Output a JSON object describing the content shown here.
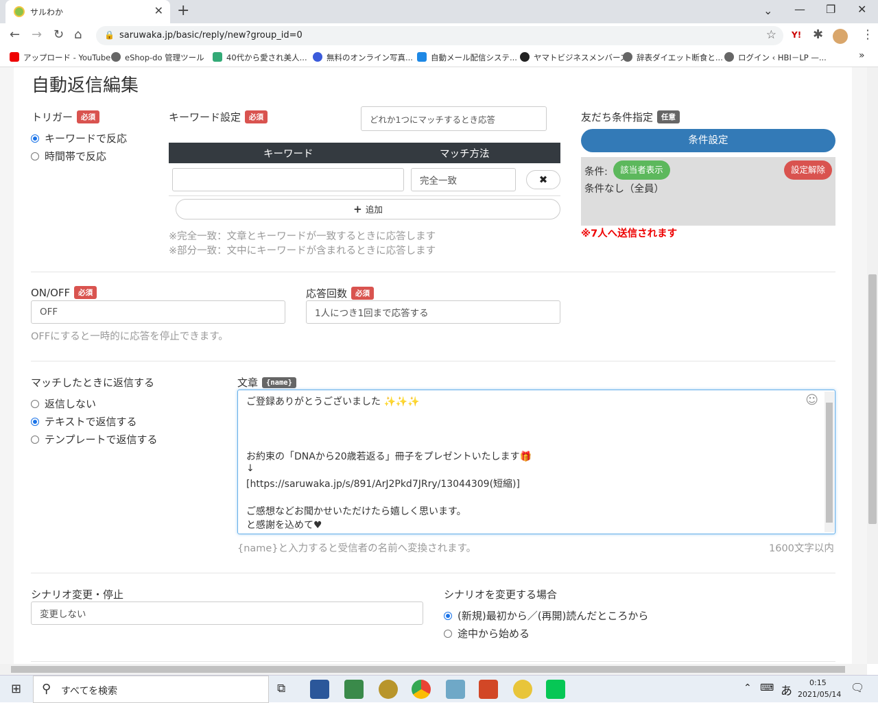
{
  "browser": {
    "tab_title": "サルわか",
    "url": "saruwaka.jp/basic/reply/new?group_id=0",
    "bookmarks": [
      "アップロード - YouTube",
      "eShop-do 管理ツール",
      "40代から愛され美人...",
      "無料のオンライン写真...",
      "自動メール配信システ...",
      "ヤマトビジネスメンバーズ",
      "辞表ダイエット断食と...",
      "ログイン ‹ HBI－LP —..."
    ]
  },
  "page": {
    "title": "自動返信編集",
    "trigger": {
      "label": "トリガー",
      "badge": "必須",
      "options": [
        "キーワードで反応",
        "時間帯で反応"
      ],
      "selected": 0
    },
    "keyword": {
      "label": "キーワード設定",
      "badge": "必須",
      "match_mode": "どれか1つにマッチするとき応答",
      "col_keyword": "キーワード",
      "col_match": "マッチ方法",
      "row_keyword": "",
      "row_match": "完全一致",
      "delete_icon": "✖",
      "add_label": "追加",
      "note1": "※完全一致：文章とキーワードが一致するときに応答します",
      "note2": "※部分一致：文中にキーワードが含まれるときに応答します"
    },
    "friend": {
      "label": "友だち条件指定",
      "badge": "任意",
      "button": "条件設定",
      "cond_label": "条件:",
      "show_target": "該当者表示",
      "clear": "設定解除",
      "cond_value": "条件なし（全員）",
      "send_note": "※7人へ送信されます"
    },
    "onoff": {
      "label": "ON/OFF",
      "badge": "必須",
      "value": "OFF",
      "note": "OFFにすると一時的に応答を停止できます。"
    },
    "count": {
      "label": "応答回数",
      "badge": "必須",
      "value": "1人につき1回まで応答する"
    },
    "reply": {
      "label": "マッチしたときに返信する",
      "options": [
        "返信しない",
        "テキストで返信する",
        "テンプレートで返信する"
      ],
      "selected": 1
    },
    "message": {
      "label": "文章",
      "badge": "{name}",
      "lines": [
        "ご登録ありがとうございました",
        "",
        "",
        "",
        "お約束の「DNAから20歳若返る」冊子をプレゼントいたします",
        "↓",
        "[https://saruwaka.jp/s/891/ArJ2Pkd7JRry/13044309(短縮)]",
        "",
        "ご感想などお聞かせいただけたら嬉しく思います。",
        "と感謝を込めて"
      ],
      "note": "{name}と入力すると受信者の名前へ変換されます。",
      "limit": "1600文字以内"
    },
    "scenario": {
      "label": "シナリオ変更・停止",
      "value": "変更しない",
      "change_label": "シナリオを変更する場合",
      "options": [
        "(新規)最初から／(再開)読んだところから",
        "途中から始める"
      ],
      "selected": 0
    }
  },
  "taskbar": {
    "search": "すべてを検索",
    "ime": "あ",
    "time": "0:15",
    "date": "2021/05/14"
  }
}
